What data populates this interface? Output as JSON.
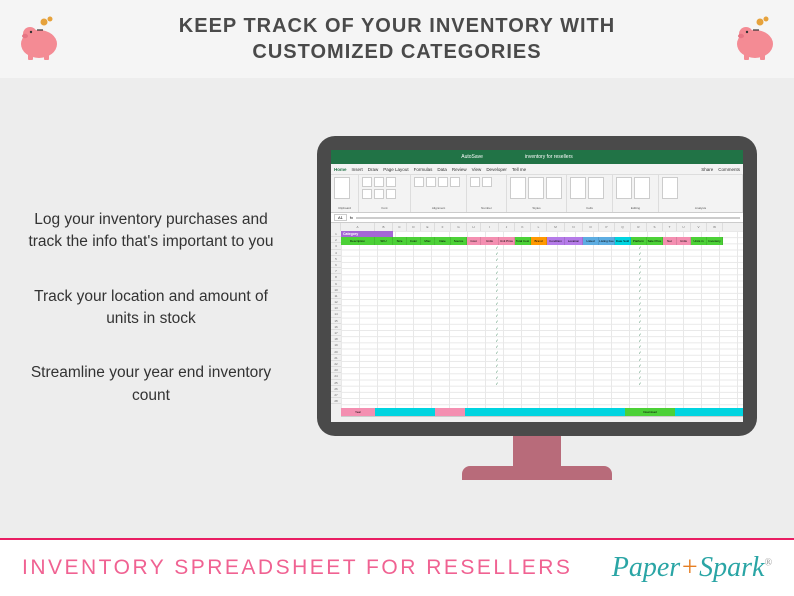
{
  "header": {
    "title_line1": "KEEP TRACK OF YOUR INVENTORY WITH",
    "title_line2": "CUSTOMIZED CATEGORIES"
  },
  "copy": {
    "p1": "Log your inventory purchases and track the info that's important to you",
    "p2": "Track your location and amount of units in stock",
    "p3": "Streamline your year end inventory count"
  },
  "excel": {
    "filename": "inventory for resellers",
    "autosave": "AutoSave",
    "menu": [
      "Home",
      "Insert",
      "Draw",
      "Page Layout",
      "Formulas",
      "Data",
      "Review",
      "View",
      "Developer",
      "Tell me"
    ],
    "share": "Share",
    "comments": "Comments",
    "ribbon_groups": [
      "Clipboard",
      "Font",
      "Alignment",
      "Number",
      "Styles",
      "Cells",
      "Editing",
      "Analysis"
    ],
    "cell_ref": "A1",
    "fx": "fx",
    "category_label": "Category",
    "headers": [
      "Description",
      "SKU",
      "Size",
      "Color",
      "Misc",
      "Date",
      "Source",
      "Cost",
      "Units Purchased",
      "Unit Price",
      "Total Cost",
      "Brand",
      "Condition",
      "Location",
      "Listed Price",
      "Listing Fee",
      "Date Sold",
      "Platform",
      "Sale Price",
      "Net",
      "Units Sold",
      "Units in Stock",
      "Inventory Cost"
    ],
    "bottom_labels": [
      "Year",
      "",
      "",
      "",
      "",
      "",
      "",
      "",
      "Download"
    ],
    "columns": [
      "A",
      "B",
      "C",
      "D",
      "E",
      "F",
      "G",
      "H",
      "I",
      "J",
      "K",
      "L",
      "M",
      "N",
      "O",
      "P",
      "Q",
      "R",
      "S",
      "T",
      "U",
      "V",
      "W",
      "X"
    ]
  },
  "footer": {
    "title": "INVENTORY SPREADSHEET FOR RESELLERS",
    "brand_paper": "Paper",
    "brand_plus": "+",
    "brand_spark": "Spark",
    "reg": "®"
  }
}
